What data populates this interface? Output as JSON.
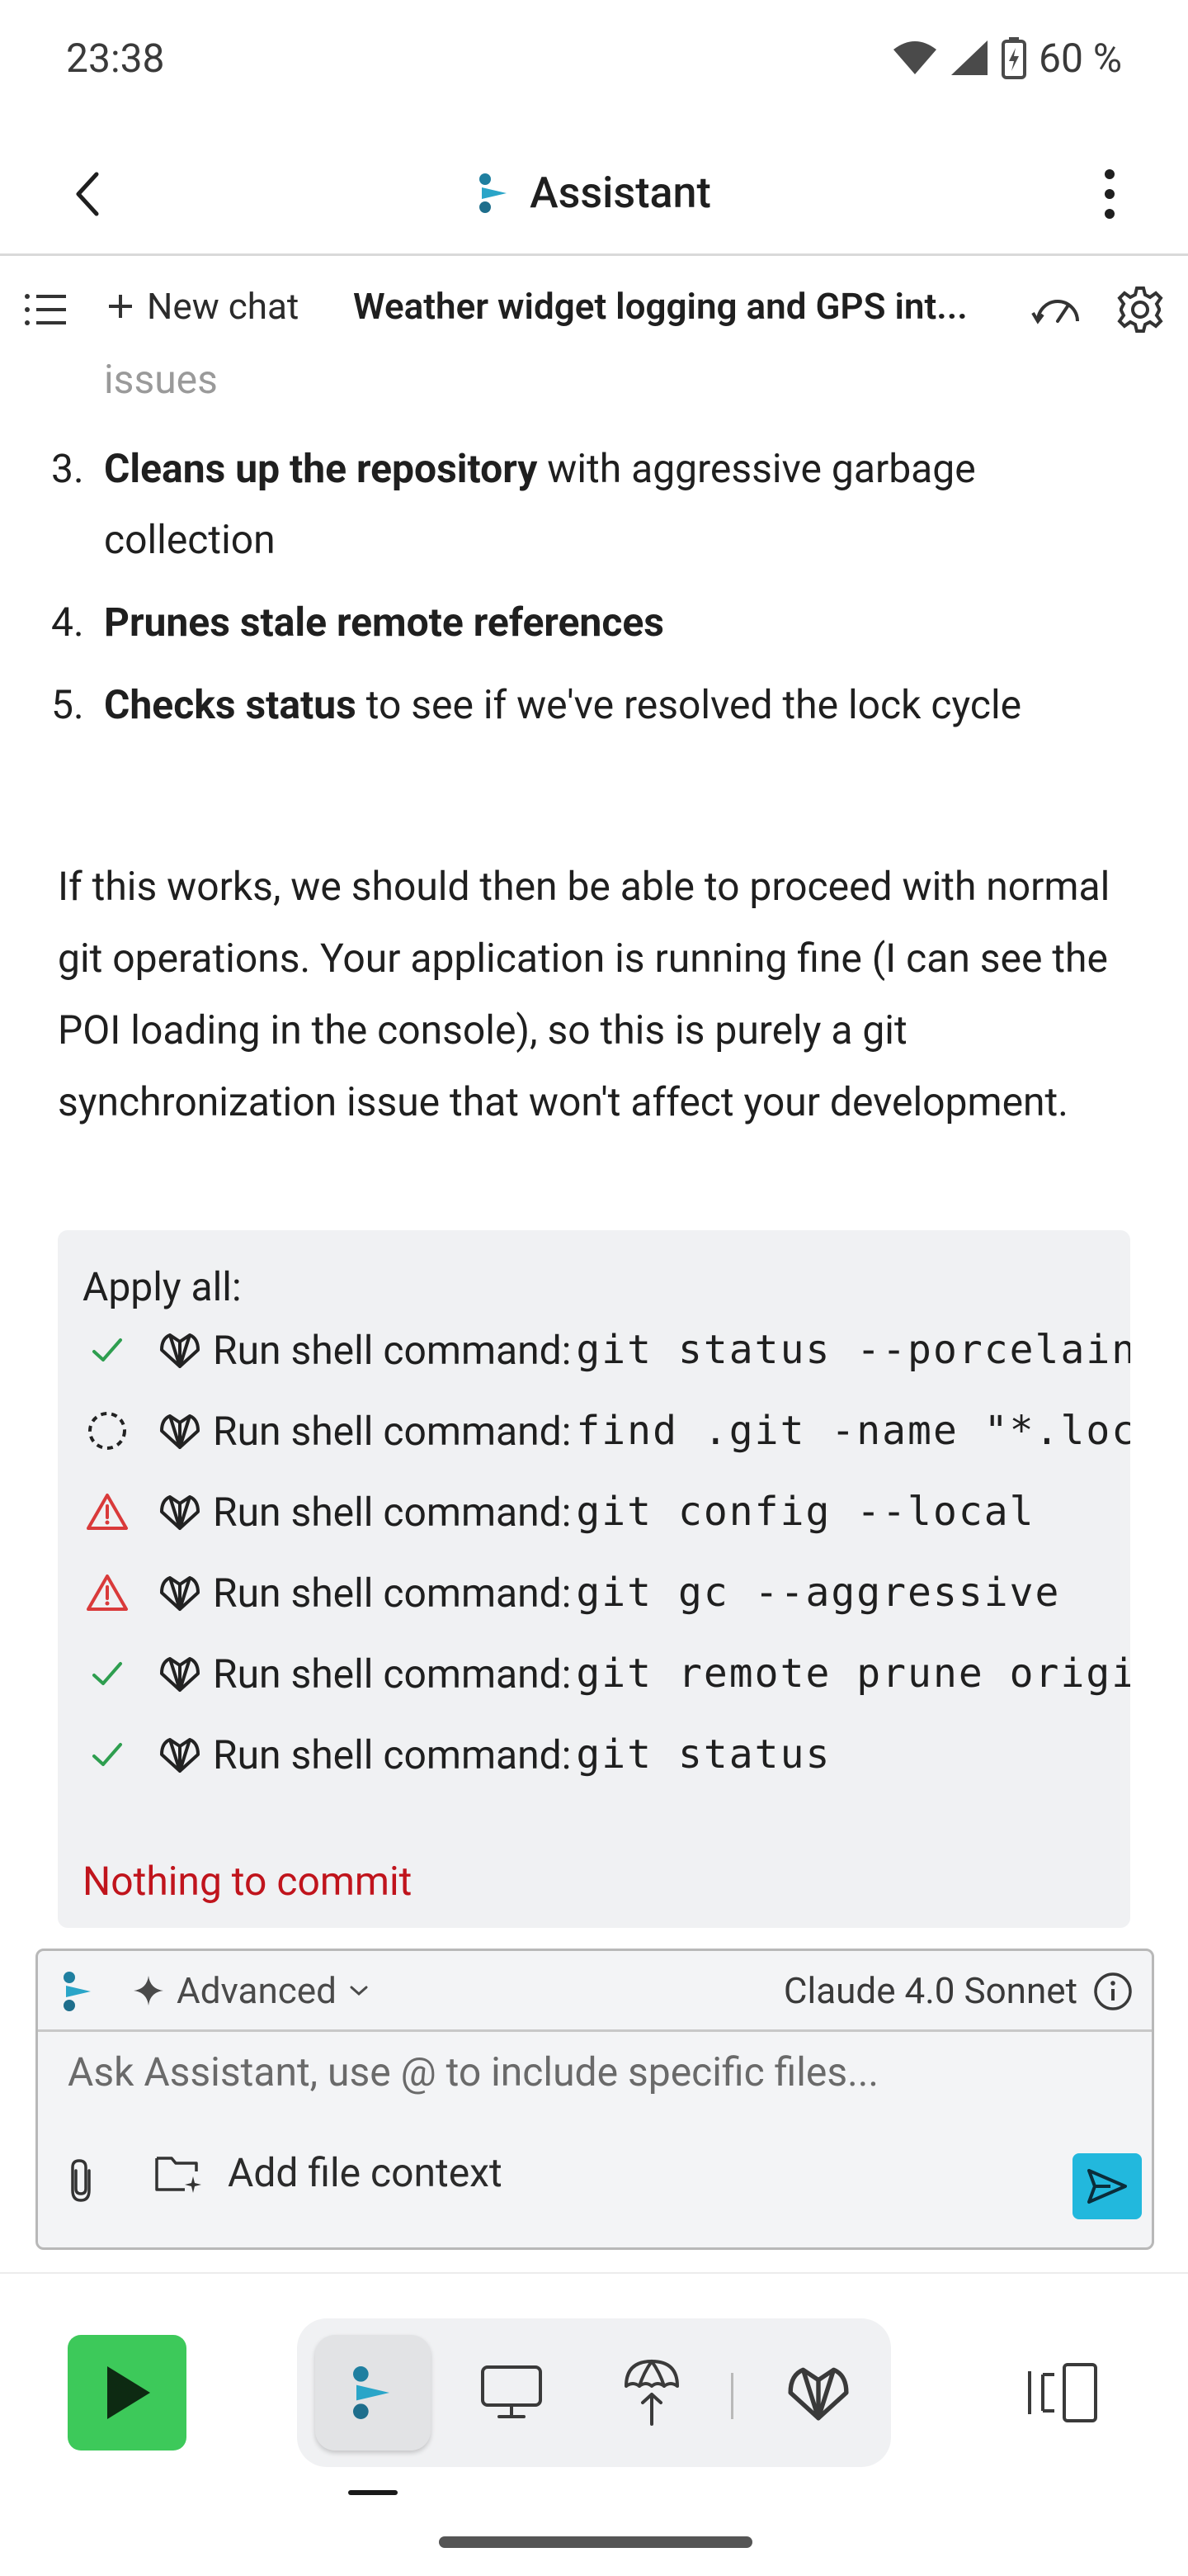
{
  "status_bar": {
    "time": "23:38",
    "battery": "60 %"
  },
  "app_bar": {
    "title": "Assistant"
  },
  "chat_toolbar": {
    "new_chat": "New chat",
    "chat_title": "Weather widget logging and GPS int..."
  },
  "content": {
    "faded_text": "issues",
    "steps": [
      {
        "num": "3.",
        "bold": "Cleans up the repository",
        "rest": " with aggressive garbage collection"
      },
      {
        "num": "4.",
        "bold": "Prunes stale remote references",
        "rest": ""
      },
      {
        "num": "5.",
        "bold": "Checks status",
        "rest": " to see if we've resolved the lock cycle"
      }
    ],
    "paragraph": "If this works, we should then be able to proceed with normal git operations. Your application is running fine (I can see the POI loading in the console), so this is purely a git synchronization issue that won't affect your development."
  },
  "apply_panel": {
    "title": "Apply all:",
    "commands": [
      {
        "status": "success",
        "label": "Run shell command:",
        "code": "git status --porcelain"
      },
      {
        "status": "pending",
        "label": "Run shell command:",
        "code": "find .git -name \"*.lock\""
      },
      {
        "status": "warning",
        "label": "Run shell command:",
        "code": "git config --local"
      },
      {
        "status": "warning",
        "label": "Run shell command:",
        "code": "git gc --aggressive"
      },
      {
        "status": "success",
        "label": "Run shell command:",
        "code": "git remote prune origin"
      },
      {
        "status": "success",
        "label": "Run shell command:",
        "code": "git status"
      }
    ],
    "result": "Nothing to commit"
  },
  "input_box": {
    "mode": "Advanced",
    "model": "Claude 4.0 Sonnet",
    "placeholder": "Ask Assistant, use @ to include specific files...",
    "add_context": "Add file context"
  },
  "colors": {
    "success": "#2e9e4f",
    "warning": "#d93a3a",
    "error_text": "#c0141c",
    "send": "#22b8dd",
    "run": "#3dc95a",
    "brand_teal": "#2a8ea8"
  }
}
